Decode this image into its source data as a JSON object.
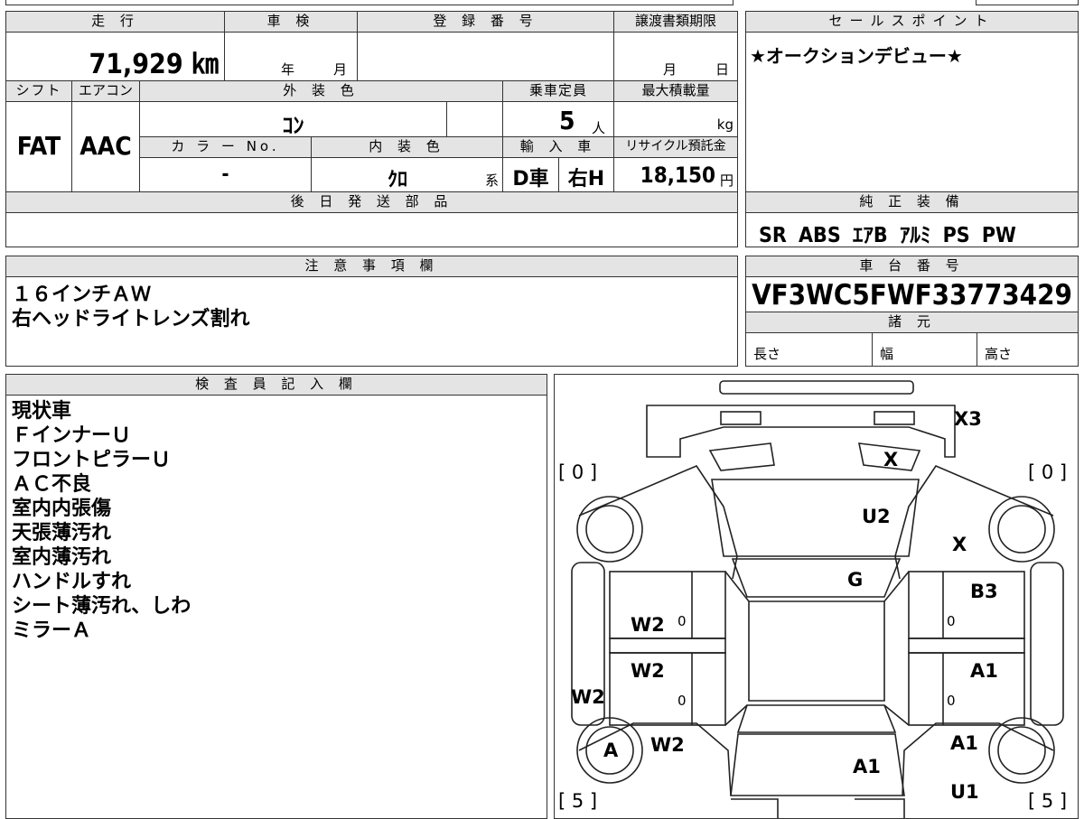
{
  "spec": {
    "mileage_header": "走 行",
    "mileage": "71,929 ㎞",
    "inspection_header": "車 検",
    "inspection_year": "年",
    "inspection_month": "月",
    "registration_header": "登 録 番 号",
    "registration_value": "",
    "transfer_header": "譲渡書類期限",
    "transfer_month": "月",
    "transfer_day": "日",
    "shift_header": "シフト",
    "shift": "FAT",
    "ac_header": "エアコン",
    "ac": "AAC",
    "exterior_header": "外 装 色",
    "exterior": "ｺﾝ",
    "capacity_header": "乗車定員",
    "capacity": "5",
    "capacity_unit": "人",
    "load_header": "最大積載量",
    "load_unit": "kg",
    "color_no_header": "カ ラ ー No.",
    "color_no": "-",
    "interior_header": "内 装 色",
    "interior": "ｸﾛ",
    "interior_suffix": "系",
    "import_header": "輸 入 車",
    "import_type": "D車",
    "steering": "右H",
    "recycle_header": "リサイクル預託金",
    "recycle": "18,150",
    "recycle_unit": "円",
    "later_parts_header": "後 日 発 送 部 品",
    "later_parts": ""
  },
  "sales": {
    "header": "セールスポイント",
    "text": "★オークションデビュー★"
  },
  "equipment": {
    "header": "純 正 装 備",
    "items": "SR ABS ｴｱB ｱﾙﾐ PS PW"
  },
  "notes": {
    "header": "注 意 事 項 欄",
    "lines": "１６インチＡＷ\n右ヘッドライトレンズ割れ"
  },
  "chassis": {
    "header": "車 台 番 号",
    "number": "VF3WC5FWF33773429",
    "specs_header": "諸 元",
    "length": "長さ",
    "width": "幅",
    "height": "高さ"
  },
  "inspector": {
    "header": "検 査 員 記 入 欄",
    "lines": "現状車\nＦインナーＵ\nフロントピラーＵ\nＡＣ不良\n室内内張傷\n天張薄汚れ\n室内薄汚れ\nハンドルすれ\nシート薄汚れ、しわ\nミラーＡ"
  },
  "diagram": {
    "tire_fl": "[ 0 ]",
    "tire_fr": "[ 0 ]",
    "tire_rl": "[ 5 ]",
    "tire_rr": "[ 5 ]",
    "marks": {
      "bumper_front": "X3",
      "headlight_r": "X",
      "hood": "U2",
      "fender_r": "X",
      "windshield": "G",
      "front_door_r": "B3",
      "front_door_l": "W2",
      "front_door_l_glass": "0",
      "front_door_r_glass": "0",
      "rear_door_l": "W2",
      "rear_door_l_glass": "0",
      "rear_door_r": "A1",
      "rear_door_r_glass": "0",
      "rocker_l": "W2",
      "wheel_rl": "A",
      "quarter_l": "W2",
      "quarter_r": "A1",
      "roof_rear": "A1",
      "rear_bumper_r": "U1"
    }
  }
}
